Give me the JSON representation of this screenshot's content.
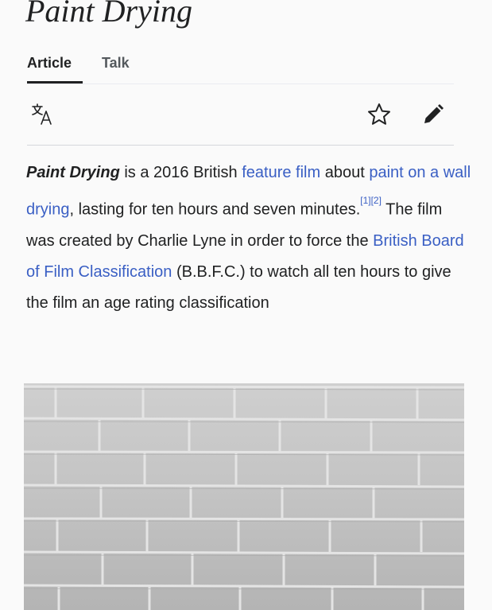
{
  "article": {
    "title": "Paint Drying",
    "tabs": [
      "Article",
      "Talk"
    ],
    "lead": {
      "subject": "Paint Drying",
      "t1": " is a 2016 British ",
      "link1": "feature film",
      "t2": " about ",
      "link2": "paint on a wall drying",
      "t3": ", lasting for ten hours and seven minutes.",
      "ref1": "[1]",
      "ref2": "[2]",
      "t4": " The film was created by Charlie Lyne in order to force the ",
      "link3": "British Board of Film Classification",
      "t5": " (B.B.F.C.) to watch all ten hours to give the film an age rating classification"
    }
  },
  "icons": {
    "translate": "translate-icon",
    "watch": "star-icon",
    "edit": "pencil-icon"
  },
  "colors": {
    "link": "#3a5fc4",
    "text": "#202122",
    "background": "#fafafa"
  }
}
